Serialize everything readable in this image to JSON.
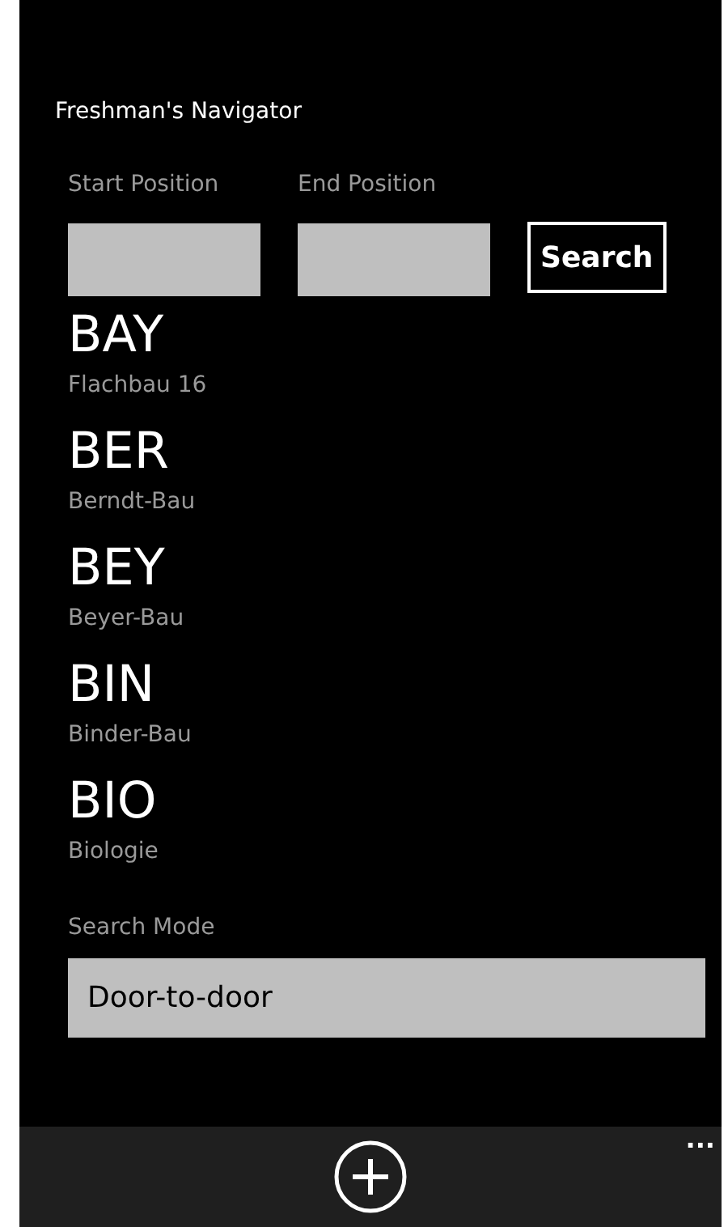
{
  "app_title": "Freshman's Navigator",
  "start_field": {
    "label": "Start Position"
  },
  "end_field": {
    "label": "End Position"
  },
  "search_button": "Search",
  "buildings": [
    {
      "code": "BAY",
      "name": "Flachbau 16"
    },
    {
      "code": "BER",
      "name": "Berndt-Bau"
    },
    {
      "code": "BEY",
      "name": "Beyer-Bau"
    },
    {
      "code": "BIN",
      "name": "Binder-Bau"
    },
    {
      "code": "BIO",
      "name": "Biologie"
    }
  ],
  "search_mode": {
    "label": "Search Mode",
    "value": "Door-to-door"
  },
  "app_bar": {
    "more": "..."
  }
}
